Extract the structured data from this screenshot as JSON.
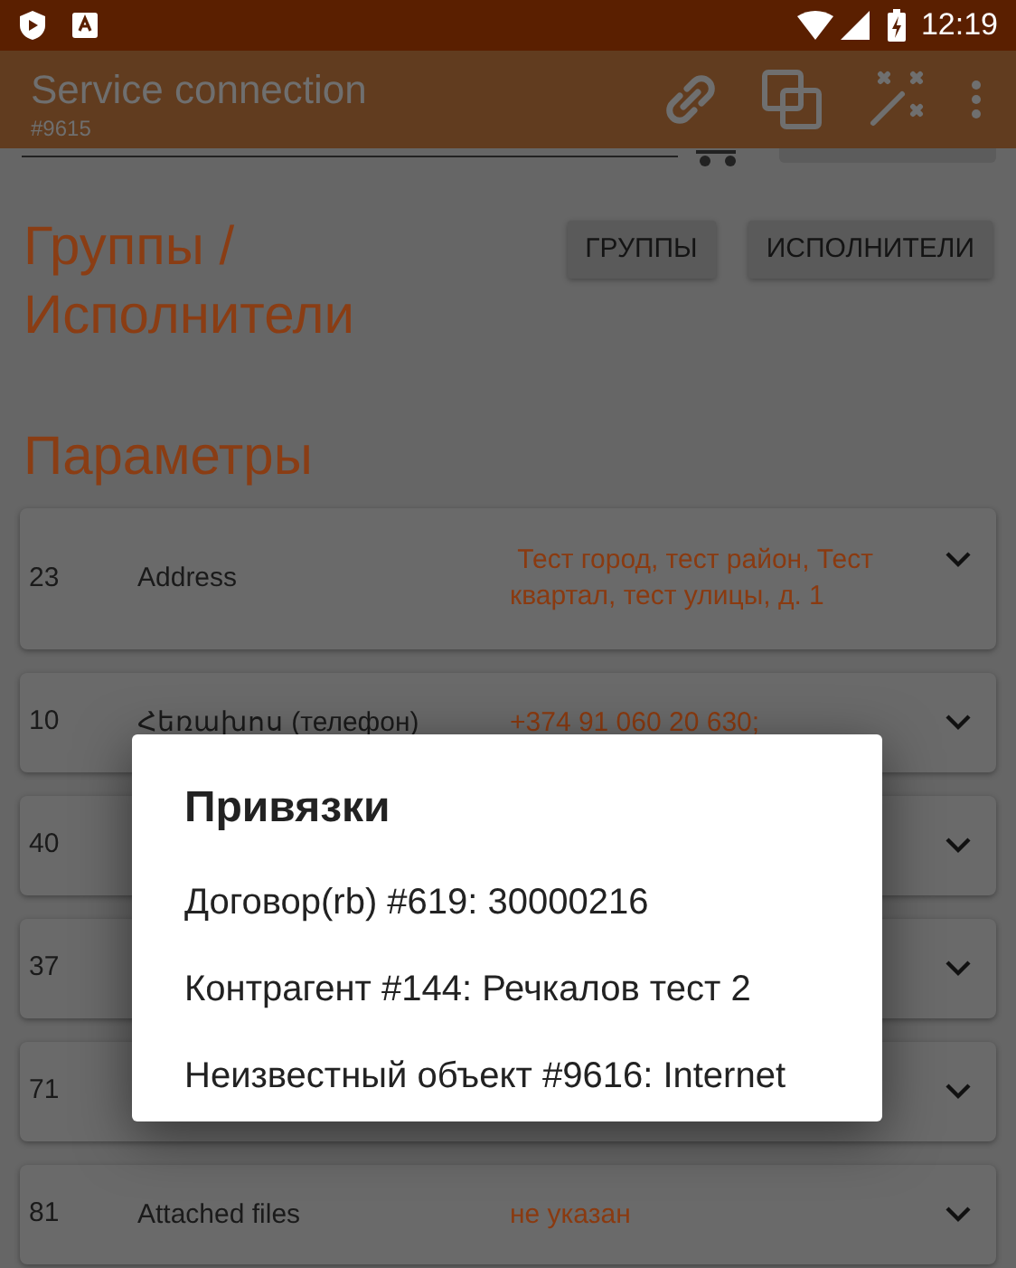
{
  "status_bar": {
    "time": "12:19"
  },
  "app_bar": {
    "title": "Service connection",
    "subtitle": "#9615"
  },
  "groups": {
    "heading": "Группы / Исполнители",
    "buttons": [
      "ГРУППЫ",
      "ИСПОЛНИТЕЛИ"
    ]
  },
  "parameters": {
    "heading": "Параметры",
    "rows": [
      {
        "id": "23",
        "label": "Address",
        "value": " Тест город, тест район, Тест квартал, тест улицы, д. 1"
      },
      {
        "id": "10",
        "label": "Հեռախոս (телефон)",
        "value": "+374 91 060 20 630;"
      },
      {
        "id": "40"
      },
      {
        "id": "37"
      },
      {
        "id": "71"
      },
      {
        "id": "81",
        "label": "Attached files",
        "value": "не указан"
      }
    ]
  },
  "dialog": {
    "title": "Привязки",
    "items": [
      "Договор(rb) #619: 30000216",
      "Контрагент #144: Речкалов тест 2",
      "Неизвестный объект #9616: Internet"
    ]
  }
}
